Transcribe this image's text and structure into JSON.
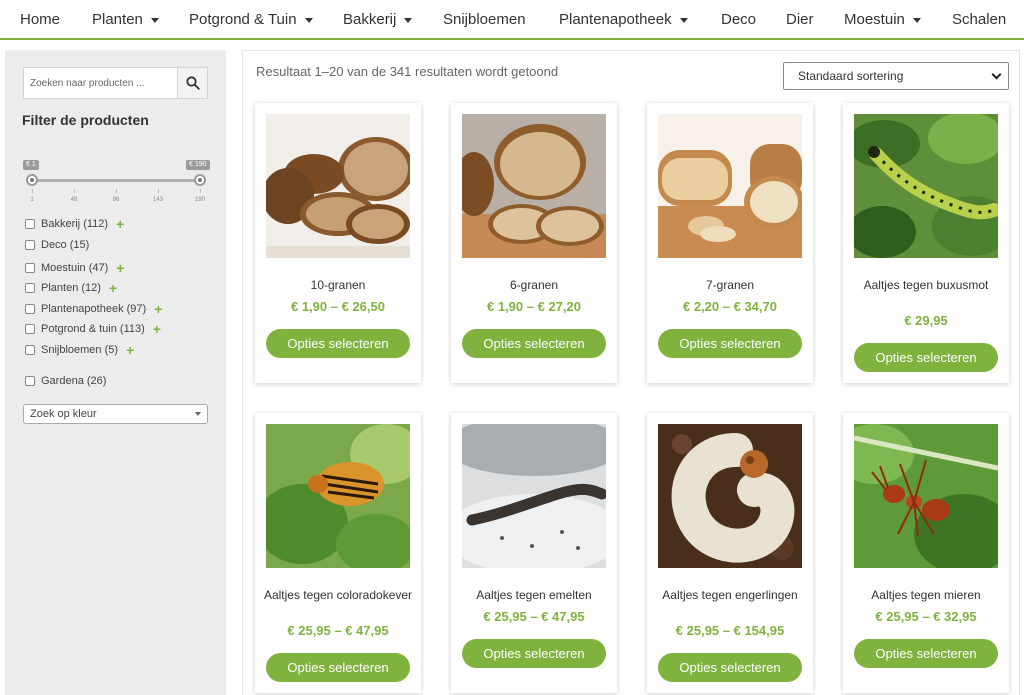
{
  "nav": [
    {
      "label": "Home",
      "dropdown": false
    },
    {
      "label": "Planten",
      "dropdown": true
    },
    {
      "label": "Potgrond & Tuin",
      "dropdown": true
    },
    {
      "label": "Bakkerij",
      "dropdown": true
    },
    {
      "label": "Snijbloemen",
      "dropdown": false
    },
    {
      "label": "Plantenapotheek",
      "dropdown": true
    },
    {
      "label": "Deco",
      "dropdown": false
    },
    {
      "label": "Dier",
      "dropdown": false
    },
    {
      "label": "Moestuin",
      "dropdown": true
    },
    {
      "label": "Schalen",
      "dropdown": false
    }
  ],
  "sidebar": {
    "search_placeholder": "Zoeken naar producten ...",
    "filter_title": "Filter de producten",
    "price": {
      "min_label": "€ 1",
      "max_label": "€ 190",
      "min": 1,
      "max": 190,
      "selected_min": 1,
      "selected_max": 190,
      "ticks": [
        "1",
        "48",
        "96",
        "143",
        "190"
      ]
    },
    "categories": [
      {
        "label": "Bakkerij",
        "count": "(112)",
        "expandable": true
      },
      {
        "label": "Deco",
        "count": "(15)",
        "expandable": false
      },
      {
        "label": "Moestuin",
        "count": "(47)",
        "expandable": true
      },
      {
        "label": "Planten",
        "count": "(12)",
        "expandable": true
      },
      {
        "label": "Plantenapotheek",
        "count": "(97)",
        "expandable": true
      },
      {
        "label": "Potgrond & tuin",
        "count": "(113)",
        "expandable": true
      },
      {
        "label": "Snijbloemen",
        "count": "(5)",
        "expandable": true
      },
      {
        "label": "Gardena",
        "count": "(26)",
        "expandable": false
      }
    ],
    "color_select": "Zoek op kleur"
  },
  "main": {
    "result_count": "Resultaat 1–20 van de 341 resultaten wordt getoond",
    "sort_selected": "Standaard sortering",
    "button_label": "Opties selecteren",
    "products": [
      {
        "name": "10-granen",
        "price": "€ 1,90 – € 26,50",
        "image": "bread-slices"
      },
      {
        "name": "6-granen",
        "price": "€ 1,90 – € 27,20",
        "image": "bread-loaf"
      },
      {
        "name": "7-granen",
        "price": "€ 2,20 – € 34,70",
        "image": "white-bread"
      },
      {
        "name": "Aaltjes tegen buxusmot",
        "price": "€ 29,95",
        "image": "caterpillar"
      },
      {
        "name": "Aaltjes tegen coloradokever",
        "price": "€ 25,95 – € 47,95",
        "image": "colorado-beetle"
      },
      {
        "name": "Aaltjes tegen emelten",
        "price": "€ 25,95 – € 47,95",
        "image": "larva"
      },
      {
        "name": "Aaltjes tegen engerlingen",
        "price": "€ 25,95 – € 154,95",
        "image": "grub"
      },
      {
        "name": "Aaltjes tegen mieren",
        "price": "€ 25,95 – € 32,95",
        "image": "ant"
      }
    ]
  },
  "colors": {
    "accent": "#7fb33d",
    "sidebar_bg": "#ececec"
  }
}
